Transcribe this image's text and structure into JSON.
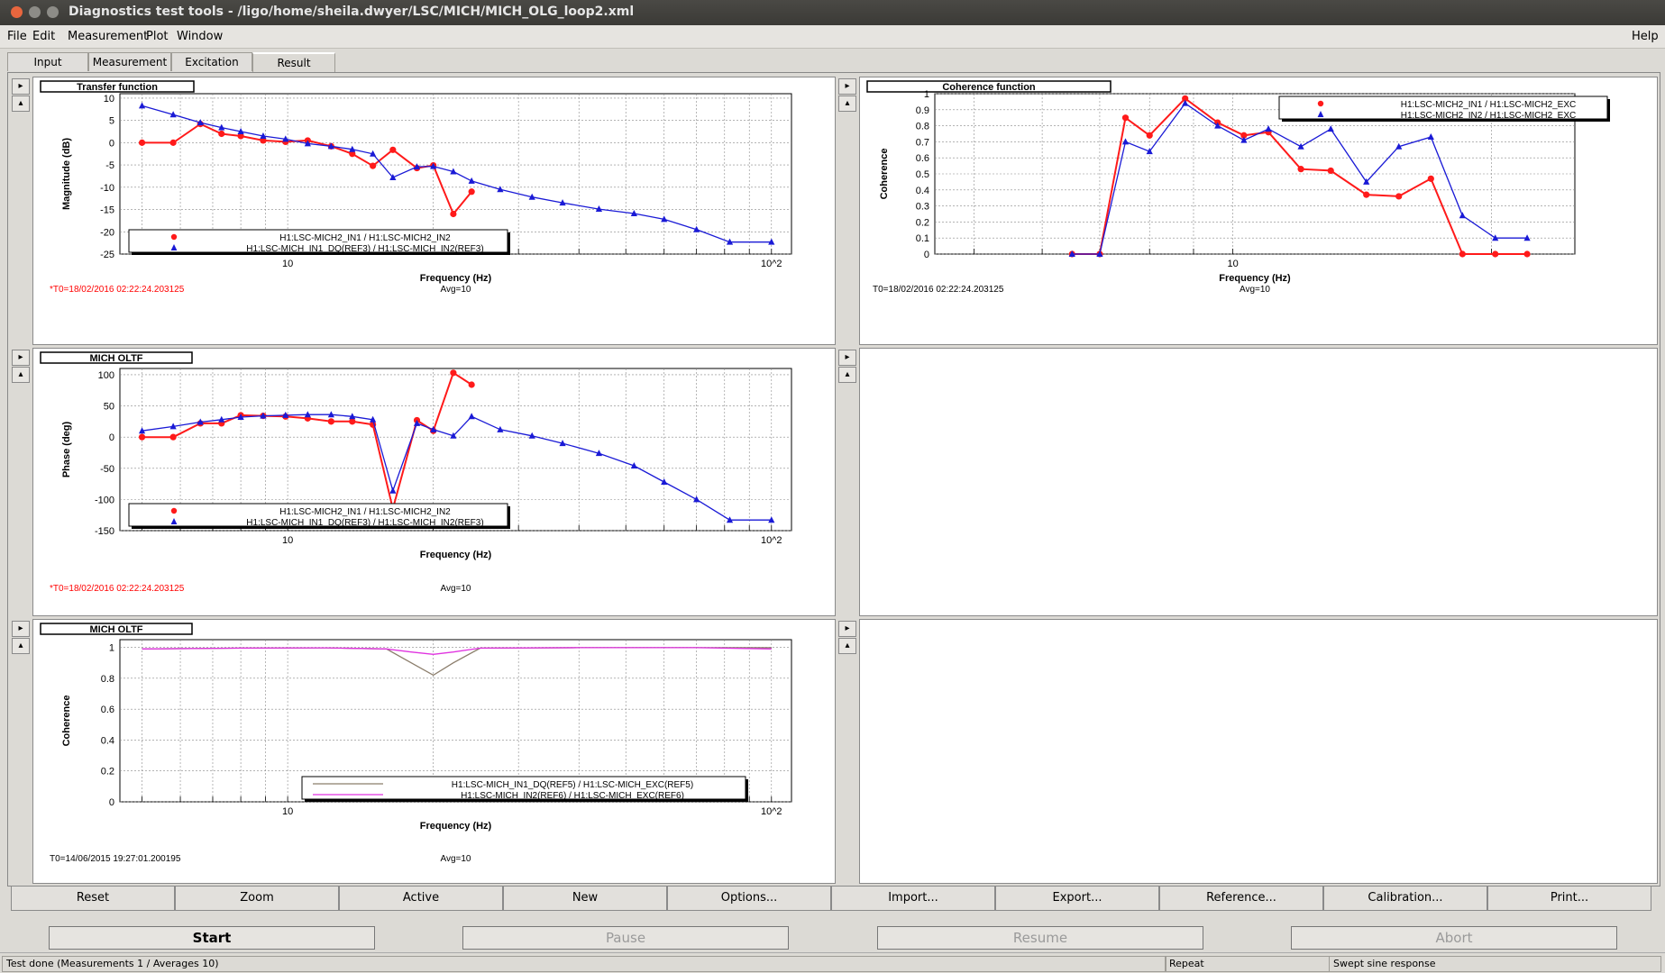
{
  "window": {
    "title": "Diagnostics test tools - /ligo/home/sheila.dwyer/LSC/MICH/MICH_OLG_loop2.xml"
  },
  "menu": [
    "File",
    "Edit",
    "Measurement",
    "Plot",
    "Window",
    "Help"
  ],
  "tabs": [
    "Input",
    "Measurement",
    "Excitation",
    "Result"
  ],
  "active_tab": "Result",
  "colors": {
    "red": "#ff1a1a",
    "blue": "#1a1ad6",
    "brown": "#8b7d6b",
    "magenta": "#e033e0",
    "timestamp_red": "#ff0000"
  },
  "pads": {
    "tf": {
      "title": "Transfer function",
      "ylabel": "Magnitude (dB)",
      "xlabel": "Frequency (Hz)",
      "t0": "*T0=18/02/2016 02:22:24.203125",
      "avg": "Avg=10",
      "legend": [
        "H1:LSC-MICH2_IN1 / H1:LSC-MICH2_IN2",
        "H1:LSC-MICH_IN1_DQ(REF3) / H1:LSC-MICH_IN2(REF3)"
      ],
      "yticks": [
        "10",
        "5",
        "0",
        "-5",
        "-10",
        "-15",
        "-20",
        "-25"
      ],
      "xticks": [
        "10",
        "10^2"
      ]
    },
    "coh": {
      "title": "Coherence function",
      "ylabel": "Coherence",
      "xlabel": "Frequency (Hz)",
      "t0": "T0=18/02/2016 02:22:24.203125",
      "avg": "Avg=10",
      "legend": [
        "H1:LSC-MICH2_IN1 / H1:LSC-MICH2_EXC",
        "H1:LSC-MICH2_IN2 / H1:LSC-MICH2_EXC"
      ],
      "yticks": [
        "1",
        "0.9",
        "0.8",
        "0.7",
        "0.6",
        "0.5",
        "0.4",
        "0.3",
        "0.2",
        "0.1",
        "0"
      ],
      "xticks": [
        "10"
      ]
    },
    "phase": {
      "title": "MICH OLTF",
      "ylabel": "Phase (deg)",
      "xlabel": "Frequency (Hz)",
      "t0": "*T0=18/02/2016 02:22:24.203125",
      "avg": "Avg=10",
      "legend": [
        "H1:LSC-MICH2_IN1 / H1:LSC-MICH2_IN2",
        "H1:LSC-MICH_IN1_DQ(REF3) / H1:LSC-MICH_IN2(REF3)"
      ],
      "yticks": [
        "100",
        "50",
        "0",
        "-50",
        "-100",
        "-150"
      ],
      "xticks": [
        "10",
        "10^2"
      ]
    },
    "coh2": {
      "title": "MICH OLTF",
      "ylabel": "Coherence",
      "xlabel": "Frequency (Hz)",
      "t0": "T0=14/06/2015 19:27:01.200195",
      "avg": "Avg=10",
      "legend": [
        "H1:LSC-MICH_IN1_DQ(REF5) / H1:LSC-MICH_EXC(REF5)",
        "H1:LSC-MICH_IN2(REF6) / H1:LSC-MICH_EXC(REF6)"
      ],
      "yticks": [
        "1",
        "0.8",
        "0.6",
        "0.4",
        "0.2",
        "0"
      ],
      "xticks": [
        "10",
        "10^2"
      ]
    }
  },
  "chart_data": [
    {
      "type": "line",
      "title": "Transfer function",
      "xlabel": "Frequency (Hz)",
      "ylabel": "Magnitude (dB)",
      "xscale": "log",
      "xlim": [
        4.5,
        110
      ],
      "ylim": [
        -25,
        11
      ],
      "series": [
        {
          "name": "H1:LSC-MICH2_IN1 / H1:LSC-MICH2_IN2",
          "color": "red",
          "marker": "circle",
          "x": [
            5,
            5.8,
            6.6,
            7.3,
            8.0,
            8.9,
            9.9,
            11.0,
            12.3,
            13.6,
            15.0,
            16.5,
            18.5,
            20.0,
            22.0,
            24.0
          ],
          "y": [
            0,
            0,
            4.2,
            2.0,
            1.5,
            0.5,
            0.2,
            0.5,
            -0.8,
            -2.5,
            -5.2,
            -1.6,
            -5.7,
            -5.1,
            -16.0,
            -11.0
          ]
        },
        {
          "name": "H1:LSC-MICH_IN1_DQ(REF3) / H1:LSC-MICH_IN2(REF3)",
          "color": "blue",
          "marker": "triangle",
          "x": [
            5,
            5.8,
            6.6,
            7.3,
            8.0,
            8.9,
            9.9,
            11.0,
            12.3,
            13.6,
            15.0,
            16.5,
            18.5,
            20.0,
            22.0,
            24.0,
            27.5,
            32.0,
            37.0,
            44.0,
            52.0,
            60.0,
            70.0,
            82.0,
            100.0
          ],
          "y": [
            8.3,
            6.3,
            4.5,
            3.4,
            2.5,
            1.5,
            0.8,
            -0.2,
            -0.8,
            -1.5,
            -2.5,
            -7.8,
            -5.4,
            -5.3,
            -6.5,
            -8.6,
            -10.5,
            -12.2,
            -13.5,
            -14.9,
            -15.9,
            -17.2,
            -19.5,
            -22.3,
            -22.3
          ]
        }
      ]
    },
    {
      "type": "line",
      "title": "Coherence function",
      "xlabel": "Frequency (Hz)",
      "ylabel": "Coherence",
      "xscale": "log",
      "xlim": [
        4.5,
        25
      ],
      "ylim": [
        0,
        1
      ],
      "series": [
        {
          "name": "H1:LSC-MICH2_IN1 / H1:LSC-MICH2_EXC",
          "color": "red",
          "marker": "circle",
          "x": [
            6.5,
            7.0,
            7.5,
            8.0,
            8.8,
            9.6,
            10.3,
            11.0,
            12.0,
            13.0,
            14.3,
            15.6,
            17.0,
            18.5,
            20.2,
            22.0
          ],
          "y": [
            0,
            0,
            0.85,
            0.74,
            0.97,
            0.82,
            0.74,
            0.76,
            0.53,
            0.52,
            0.37,
            0.36,
            0.47,
            0,
            0,
            0
          ]
        },
        {
          "name": "H1:LSC-MICH2_IN2 / H1:LSC-MICH2_EXC",
          "color": "blue",
          "marker": "triangle",
          "x": [
            6.5,
            7.0,
            7.5,
            8.0,
            8.8,
            9.6,
            10.3,
            11.0,
            12.0,
            13.0,
            14.3,
            15.6,
            17.0,
            18.5,
            20.2,
            22.0
          ],
          "y": [
            0,
            0,
            0.7,
            0.64,
            0.94,
            0.8,
            0.71,
            0.78,
            0.67,
            0.78,
            0.45,
            0.67,
            0.73,
            0.24,
            0.1,
            0.1
          ]
        }
      ]
    },
    {
      "type": "line",
      "title": "MICH OLTF",
      "xlabel": "Frequency (Hz)",
      "ylabel": "Phase (deg)",
      "xscale": "log",
      "xlim": [
        4.5,
        110
      ],
      "ylim": [
        -150,
        110
      ],
      "series": [
        {
          "name": "H1:LSC-MICH2_IN1 / H1:LSC-MICH2_IN2",
          "color": "red",
          "marker": "circle",
          "x": [
            5,
            5.8,
            6.6,
            7.3,
            8.0,
            8.9,
            9.9,
            11.0,
            12.3,
            13.6,
            15.0,
            16.5,
            18.5,
            20.0,
            22.0,
            24.0
          ],
          "y": [
            0,
            0,
            22,
            22,
            35,
            34,
            33,
            30,
            25,
            25,
            20,
            -115,
            27,
            10,
            103,
            84
          ]
        },
        {
          "name": "H1:LSC-MICH_IN1_DQ(REF3) / H1:LSC-MICH_IN2(REF3)",
          "color": "blue",
          "marker": "triangle",
          "x": [
            5,
            5.8,
            6.6,
            7.3,
            8.0,
            8.9,
            9.9,
            11.0,
            12.3,
            13.6,
            15.0,
            16.5,
            18.5,
            20.0,
            22.0,
            24.0,
            27.5,
            32.0,
            37.0,
            44.0,
            52.0,
            60.0,
            70.0,
            82.0,
            100.0
          ],
          "y": [
            10,
            17,
            24,
            28,
            32,
            34,
            35,
            36,
            36,
            33,
            28,
            -86,
            22,
            12,
            2,
            33,
            12,
            2,
            -10,
            -26,
            -46,
            -72,
            -100,
            -133,
            -133
          ]
        }
      ]
    },
    {
      "type": "line",
      "title": "MICH OLTF",
      "xlabel": "Frequency (Hz)",
      "ylabel": "Coherence",
      "xscale": "log",
      "xlim": [
        4.5,
        110
      ],
      "ylim": [
        0,
        1.05
      ],
      "series": [
        {
          "name": "H1:LSC-MICH_IN1_DQ(REF5) / H1:LSC-MICH_EXC(REF5)",
          "color": "brown",
          "marker": "none",
          "x": [
            5,
            8,
            12,
            16,
            18,
            20,
            22,
            25,
            40,
            70,
            100
          ],
          "y": [
            0.99,
            0.995,
            0.997,
            0.99,
            0.9,
            0.82,
            0.9,
            0.995,
            0.998,
            0.998,
            0.998
          ]
        },
        {
          "name": "H1:LSC-MICH_IN2(REF6) / H1:LSC-MICH_EXC(REF6)",
          "color": "magenta",
          "marker": "none",
          "x": [
            5,
            8,
            12,
            16,
            18,
            20,
            22,
            25,
            40,
            70,
            100
          ],
          "y": [
            0.99,
            0.995,
            0.997,
            0.99,
            0.97,
            0.955,
            0.97,
            0.995,
            0.998,
            0.998,
            0.99
          ]
        }
      ]
    }
  ],
  "toolbar": [
    "Reset",
    "Zoom",
    "Active",
    "New",
    "Options...",
    "Import...",
    "Export...",
    "Reference...",
    "Calibration...",
    "Print..."
  ],
  "controls": {
    "start": "Start",
    "pause": "Pause",
    "resume": "Resume",
    "abort": "Abort"
  },
  "status": {
    "message": "Test done (Measurements 1 / Averages 10)",
    "mode": "Repeat",
    "type": "Swept sine response"
  }
}
